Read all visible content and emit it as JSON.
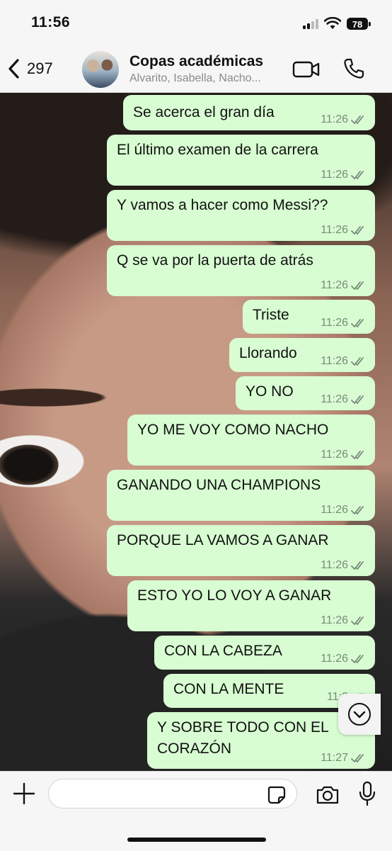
{
  "status": {
    "time": "11:56",
    "battery": "78"
  },
  "header": {
    "back_count": "297",
    "title": "Copas académicas",
    "subtitle": "Alvarito, Isabella, Nacho..."
  },
  "messages": [
    {
      "text": "Se acerca el gran día",
      "time": "11:26"
    },
    {
      "text": "El último examen de la carrera",
      "time": "11:26"
    },
    {
      "text": "Y vamos a hacer como Messi??",
      "time": "11:26"
    },
    {
      "text": "Q se va por la puerta de atrás",
      "time": "11:26"
    },
    {
      "text": "Triste",
      "time": "11:26"
    },
    {
      "text": "Llorando",
      "time": "11:26"
    },
    {
      "text": "YO NO",
      "time": "11:26"
    },
    {
      "text": "YO ME VOY COMO NACHO",
      "time": "11:26"
    },
    {
      "text": "GANANDO UNA CHAMPIONS",
      "time": "11:26"
    },
    {
      "text": "PORQUE LA VAMOS A GANAR",
      "time": "11:26"
    },
    {
      "text": "ESTO YO LO VOY A GANAR",
      "time": "11:26"
    },
    {
      "text": "CON LA CABEZA",
      "time": "11:26"
    },
    {
      "text": "CON LA MENTE",
      "time": "11:2"
    },
    {
      "text": "Y SOBRE TODO CON EL\nCORAZÓN",
      "time": "11:27"
    }
  ],
  "composer": {
    "placeholder": ""
  },
  "colors": {
    "bubble": "#d8fdd2",
    "header_bg": "#f6f6f6"
  },
  "icons": {
    "back": "chevron-left-icon",
    "video": "video-call-icon",
    "phone": "phone-icon",
    "scroll": "chevron-down-icon",
    "plus": "plus-icon",
    "sticker": "sticker-icon",
    "camera": "camera-icon",
    "mic": "microphone-icon"
  }
}
